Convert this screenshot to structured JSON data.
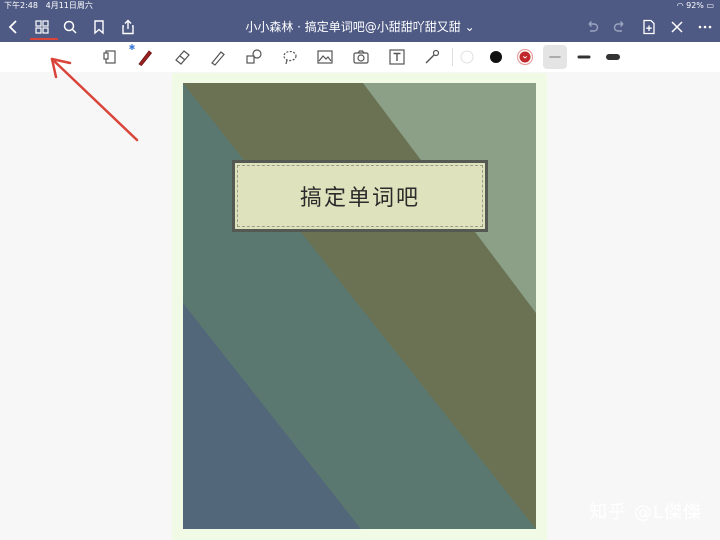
{
  "status": {
    "time": "下午2:48",
    "date": "4月11日周六",
    "battery": "92%"
  },
  "nav": {
    "title": "小小森林 · 搞定单词吧@小甜甜吖甜又甜"
  },
  "document": {
    "cover_title": "搞定单词吧"
  },
  "watermark": "知乎 @L傑傑",
  "colors": {
    "nav": "#4e5a84",
    "accent": "#d9453a",
    "pen": "#9b2222"
  }
}
